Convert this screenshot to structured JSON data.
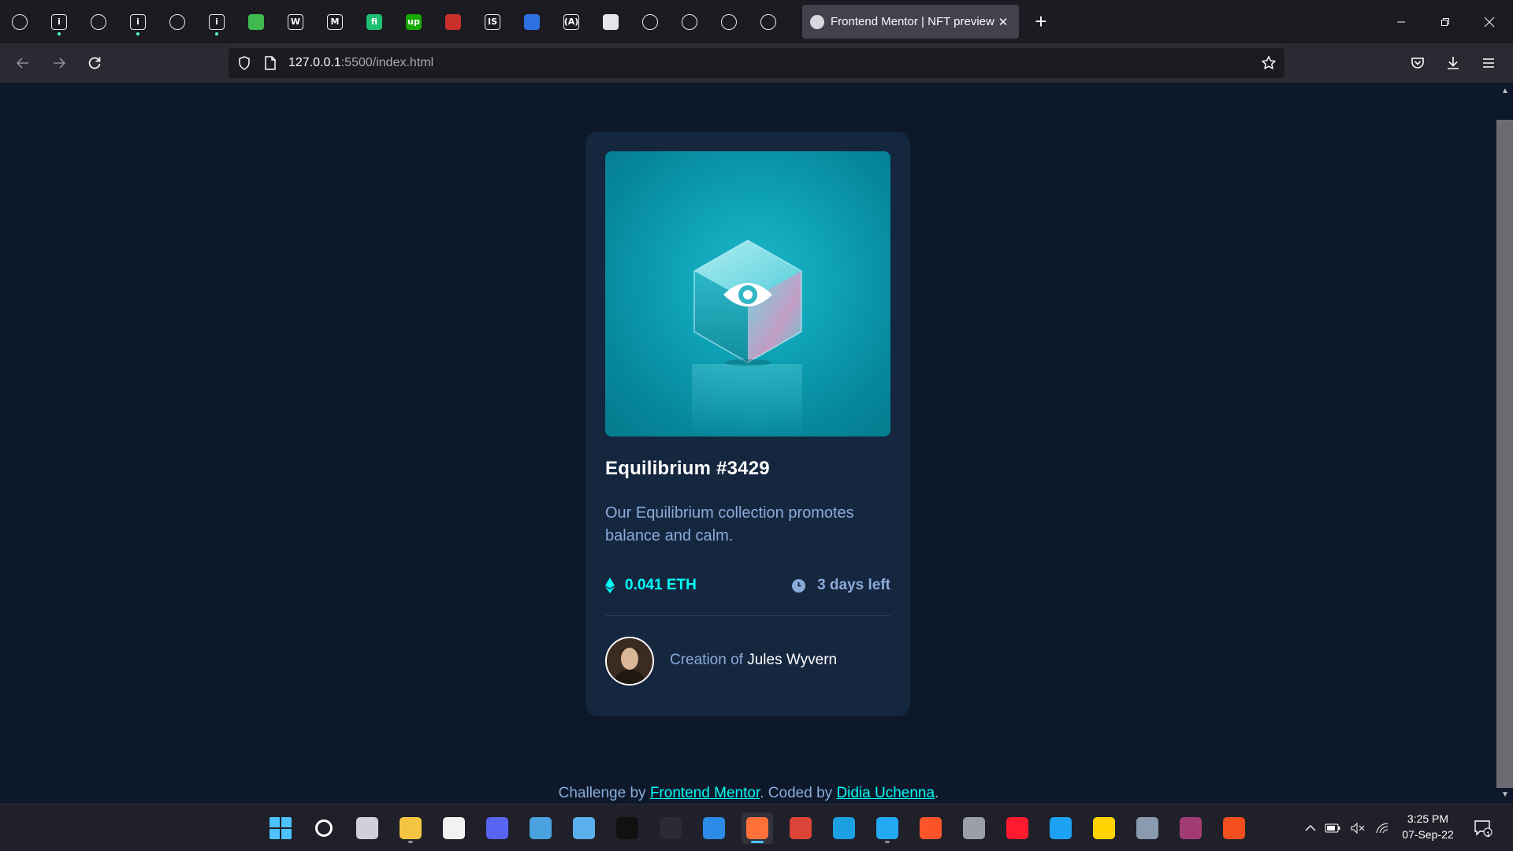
{
  "browser": {
    "pinned_tabs": [
      {
        "icon": "github-icon",
        "glyph": "",
        "color": "#1c1b22",
        "dot": false
      },
      {
        "icon": "info-icon",
        "glyph": "i",
        "color": "#1c1b22",
        "dot": true
      },
      {
        "icon": "codepen-icon",
        "glyph": "",
        "color": "#1c1b22",
        "dot": false
      },
      {
        "icon": "info-icon",
        "glyph": "i",
        "color": "#1c1b22",
        "dot": true
      },
      {
        "icon": "globe-icon",
        "glyph": "",
        "color": "#1c1b22",
        "dot": false
      },
      {
        "icon": "info-icon",
        "glyph": "i",
        "color": "#1c1b22",
        "dot": true
      },
      {
        "icon": "frontendmentor-icon",
        "glyph": "",
        "color": "#3fba4f",
        "dot": false
      },
      {
        "icon": "wellfound-icon",
        "glyph": "W",
        "color": "#1c1b22",
        "dot": false
      },
      {
        "icon": "medium-icon",
        "glyph": "M",
        "color": "#1c1b22",
        "dot": false
      },
      {
        "icon": "fiverr-icon",
        "glyph": "fi",
        "color": "#1dbf73",
        "dot": false
      },
      {
        "icon": "upwork-icon",
        "glyph": "up",
        "color": "#14a800",
        "dot": false
      },
      {
        "icon": "design-icon",
        "glyph": "",
        "color": "#c9302c",
        "dot": false
      },
      {
        "icon": "is-icon",
        "glyph": "IS",
        "color": "#1c1b22",
        "dot": false
      },
      {
        "icon": "bookmark-icon",
        "glyph": "",
        "color": "#2f6fe4",
        "dot": false
      },
      {
        "icon": "scrimba-icon",
        "glyph": "(A)",
        "color": "#1c1b22",
        "dot": false
      },
      {
        "icon": "page-icon",
        "glyph": "",
        "color": "#e6e6ea",
        "dot": false
      },
      {
        "icon": "slack-icon",
        "glyph": "",
        "color": "#1c1b22",
        "dot": false
      },
      {
        "icon": "globe-icon",
        "glyph": "",
        "color": "#1c1b22",
        "dot": false
      },
      {
        "icon": "diamond-icon",
        "glyph": "",
        "color": "#1c1b22",
        "dot": false
      },
      {
        "icon": "fire-icon",
        "glyph": "",
        "color": "#1c1b22",
        "dot": false
      }
    ],
    "active_tab_title": "Frontend Mentor | NFT preview",
    "url_host": "127.0.0.1",
    "url_rest": ":5500/index.html"
  },
  "card": {
    "title": "Equilibrium #3429",
    "description": "Our Equilibrium collection promotes balance and calm.",
    "price": "0.041 ETH",
    "time_left": "3 days left",
    "creator_prefix": "Creation of",
    "creator_name": "Jules Wyvern"
  },
  "attribution": {
    "prefix": "Challenge by",
    "link1": "Frontend Mentor",
    "middle": ". Coded by",
    "link2": "Didia Uchenna",
    "suffix": "."
  },
  "colors": {
    "page_bg": "#0d192b",
    "card_bg": "#15263f",
    "cyan": "#00fff8",
    "soft_blue": "#8bacd9"
  },
  "taskbar": {
    "apps": [
      {
        "name": "windows-start-icon",
        "color": "#4cc2ff",
        "active": false,
        "running": false
      },
      {
        "name": "search-icon",
        "color": "#ffffff",
        "active": false,
        "running": false
      },
      {
        "name": "task-view-icon",
        "color": "#d0d0d8",
        "active": false,
        "running": false
      },
      {
        "name": "file-explorer-icon",
        "color": "#f5c542",
        "active": false,
        "running": true
      },
      {
        "name": "microsoft-store-icon",
        "color": "#f2f2f2",
        "active": false,
        "running": false
      },
      {
        "name": "discord-icon",
        "color": "#5865f2",
        "active": false,
        "running": false
      },
      {
        "name": "control-panel-icon",
        "color": "#4aa3df",
        "active": false,
        "running": false
      },
      {
        "name": "notepad-icon",
        "color": "#5ab0ea",
        "active": false,
        "running": false
      },
      {
        "name": "terminal-icon",
        "color": "#111111",
        "active": false,
        "running": false
      },
      {
        "name": "powershell-icon",
        "color": "#2b2b36",
        "active": false,
        "running": false
      },
      {
        "name": "document-icon",
        "color": "#2b8be6",
        "active": false,
        "running": false
      },
      {
        "name": "firefox-icon",
        "color": "#ff7139",
        "active": true,
        "running": true
      },
      {
        "name": "chrome-icon",
        "color": "#db4437",
        "active": false,
        "running": false
      },
      {
        "name": "edge-icon",
        "color": "#1ba1e2",
        "active": false,
        "running": false
      },
      {
        "name": "vscode-icon",
        "color": "#23a9f2",
        "active": false,
        "running": true
      },
      {
        "name": "brave-icon",
        "color": "#fb542b",
        "active": false,
        "running": false
      },
      {
        "name": "calculator-icon",
        "color": "#9aa0a6",
        "active": false,
        "running": false
      },
      {
        "name": "opera-icon",
        "color": "#ff1b2d",
        "active": false,
        "running": false
      },
      {
        "name": "twitter-icon",
        "color": "#1da1f2",
        "active": false,
        "running": false
      },
      {
        "name": "sticky-notes-icon",
        "color": "#ffd400",
        "active": false,
        "running": false
      },
      {
        "name": "settings-icon",
        "color": "#8a9bb0",
        "active": false,
        "running": false
      },
      {
        "name": "winrar-icon",
        "color": "#a33b73",
        "active": false,
        "running": false
      },
      {
        "name": "figma-icon",
        "color": "#f24e1e",
        "active": false,
        "running": false
      }
    ],
    "time": "3:25 PM",
    "date": "07-Sep-22",
    "notification_count": "1"
  }
}
